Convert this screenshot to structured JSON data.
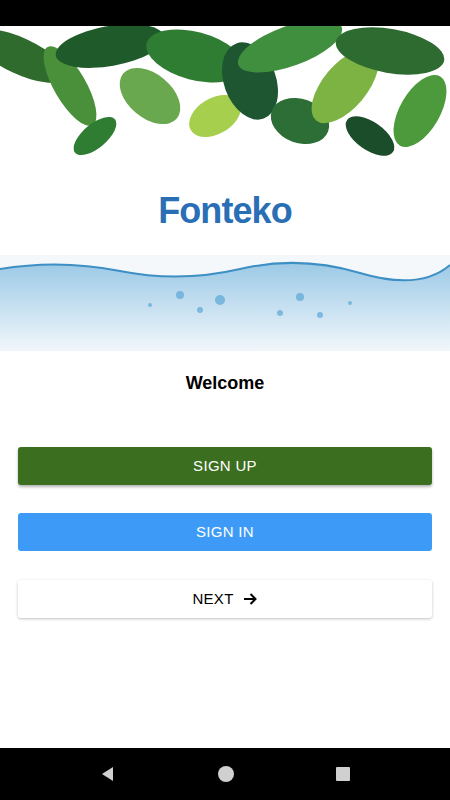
{
  "logo": "Fonteko",
  "welcome": "Welcome",
  "buttons": [
    {
      "label": "SIGN UP",
      "kind": "primary"
    },
    {
      "label": "SIGN IN",
      "kind": "secondary"
    },
    {
      "label": "NEXT",
      "kind": "next"
    }
  ]
}
